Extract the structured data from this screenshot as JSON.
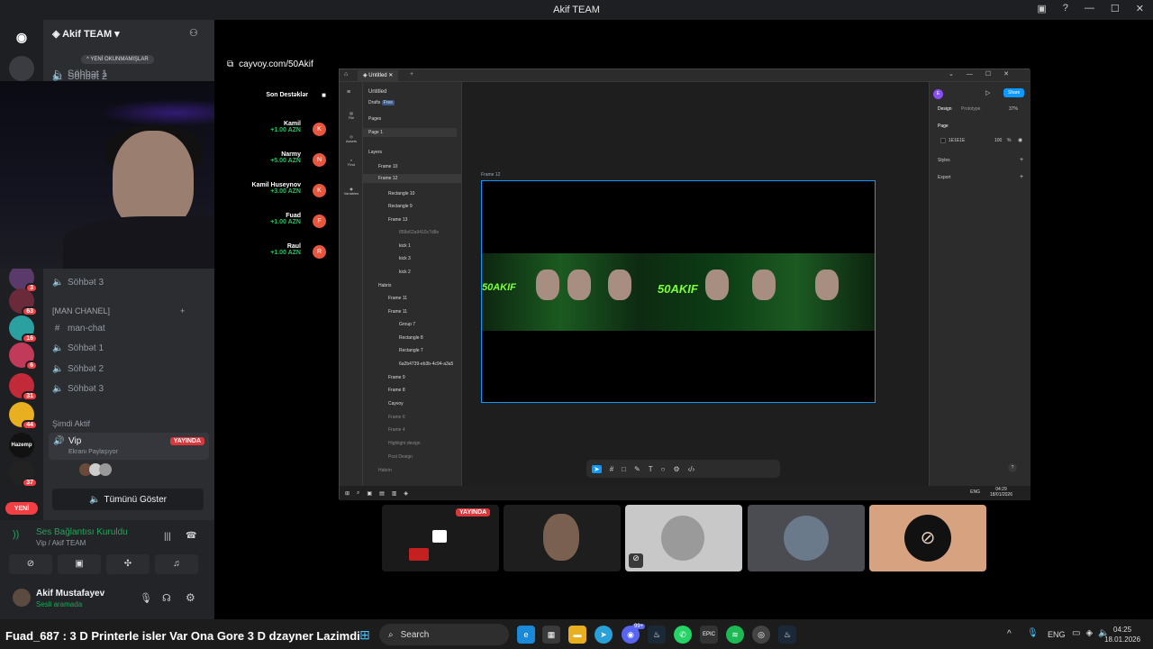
{
  "window": {
    "title": "Akif TEAM"
  },
  "server": {
    "name": "Akif TEAM",
    "unread_pill": "YENİ OKUNMAMIŞLAR"
  },
  "rail_badges": [
    "3",
    "63",
    "16",
    "6",
    "31",
    "44",
    "37"
  ],
  "rail_new": "YENİ",
  "rail_labels": {
    "tazemp": "Hazemp"
  },
  "channels_top": [
    "Söhbət 1",
    "Söhbət 2"
  ],
  "channels_mid": {
    "c3": "Söhbət 3",
    "category": "[MAN CHANEL]",
    "text_channel": "man-chat",
    "v1": "Söhbət 1",
    "v2": "Söhbət 2",
    "v3": "Söhbət 3"
  },
  "active": {
    "header": "Şimdi Aktif",
    "name": "Vip",
    "status": "Ekranı Paylaşıyor",
    "live": "YAYINDA",
    "show_all": "Tümünü Göster"
  },
  "link": "cayvoy.com/50Akif",
  "donations": {
    "title": "Son Destəklər",
    "items": [
      {
        "name": "Kamil",
        "amount": "+1.00 AZN",
        "initial": "K"
      },
      {
        "name": "Narmy",
        "amount": "+5.00 AZN",
        "initial": "N"
      },
      {
        "name": "Kamil Huseynov",
        "amount": "+3.00 AZN",
        "initial": "K"
      },
      {
        "name": "Fuad",
        "amount": "+1.00 AZN",
        "initial": "F"
      },
      {
        "name": "Raul",
        "amount": "+1.00 AZN",
        "initial": "R"
      }
    ]
  },
  "voice": {
    "status": "Ses Bağlantısı Kuruldu",
    "location": "Vip / Akif TEAM"
  },
  "user": {
    "name": "Akif Mustafayev",
    "status": "Sesli aramada"
  },
  "figma": {
    "tab": "Untitled",
    "file_name": "Untitled",
    "drafts": "Drafts",
    "plan": "Free",
    "pages_label": "Pages",
    "page1": "Page 1",
    "layers_label": "Layers",
    "layers": [
      "Frame 10",
      "Frame 12",
      "Rectangle 10",
      "Rectangle 9",
      "Frame 13",
      "858e62a9410c7d8e",
      "kick 1",
      "kick 3",
      "kick 2",
      "Habrix",
      "Frame 11",
      "Frame 11",
      "Group 7",
      "Rectangle 8",
      "Rectangle 7",
      "6a2b4739-eb3b-4c94-a3a5",
      "Frame 9",
      "Frame 8",
      "Cayvoy",
      "Frame 6",
      "Frame 4",
      "Highlight design",
      "Post Design",
      "Habrin"
    ],
    "frame_label": "Frame 12",
    "banner_text": "50AKIF",
    "right": {
      "design": "Design",
      "prototype": "Prototype",
      "zoom": "37%",
      "page": "Page",
      "color": "1E1E1E",
      "opacity": "100",
      "pct": "%",
      "styles": "Styles",
      "export": "Export",
      "share": "Share",
      "avatar": "E"
    },
    "left_icons": [
      "File",
      "Assets",
      "Find",
      "Variables"
    ],
    "taskbar": {
      "lang": "ENG",
      "time": "04:29",
      "date": "18/01/2026"
    }
  },
  "participants": {
    "live": "YAYINDA"
  },
  "ticker": "Fuad_687 : 3 D Printerle isler Var Ona Gore 3 D dzayner Lazimdi",
  "taskbar": {
    "search": "Search",
    "lang": "ENG",
    "time": "04:25",
    "date": "18.01.2026",
    "badge": "99+"
  }
}
